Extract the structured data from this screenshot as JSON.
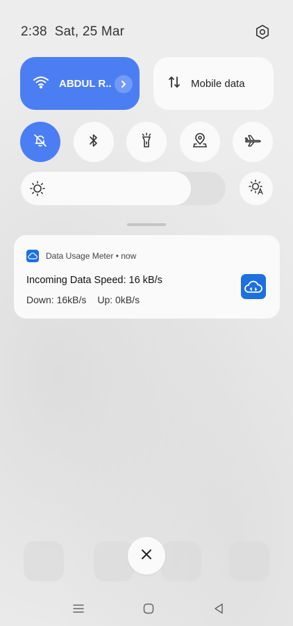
{
  "status": {
    "time": "2:38",
    "date": "Sat, 25 Mar",
    "settings_icon": "gear-icon"
  },
  "tiles": {
    "wifi": {
      "label": "ABDUL R..",
      "icon": "wifi-icon",
      "active": true
    },
    "mobile_data": {
      "label": "Mobile data",
      "icon": "data-arrows-icon",
      "active": false
    }
  },
  "toggles": [
    {
      "name": "do-not-disturb",
      "icon": "bell-off-icon",
      "active": true
    },
    {
      "name": "bluetooth",
      "icon": "bluetooth-icon",
      "active": false
    },
    {
      "name": "flashlight",
      "icon": "flashlight-icon",
      "active": false
    },
    {
      "name": "location",
      "icon": "location-icon",
      "active": false
    },
    {
      "name": "airplane-mode",
      "icon": "airplane-icon",
      "active": false
    }
  ],
  "brightness": {
    "level": 0.83,
    "icon": "sun-icon",
    "auto_icon": "auto-brightness-icon"
  },
  "notification": {
    "app_name": "Data Usage Meter",
    "time": "now",
    "header": "Data Usage Meter • now",
    "title": "Incoming Data Speed: 16 kB/s",
    "down": "Down: 16kB/s",
    "up": "Up: 0kB/s",
    "app_icon": "cloud-icon"
  },
  "colors": {
    "accent": "#4c7ef3",
    "app_icon": "#1e6fe0",
    "background": "#ececec",
    "tile": "#fafafa"
  },
  "nav": {
    "recents_icon": "recents-icon",
    "home_icon": "home-icon",
    "back_icon": "back-icon"
  }
}
